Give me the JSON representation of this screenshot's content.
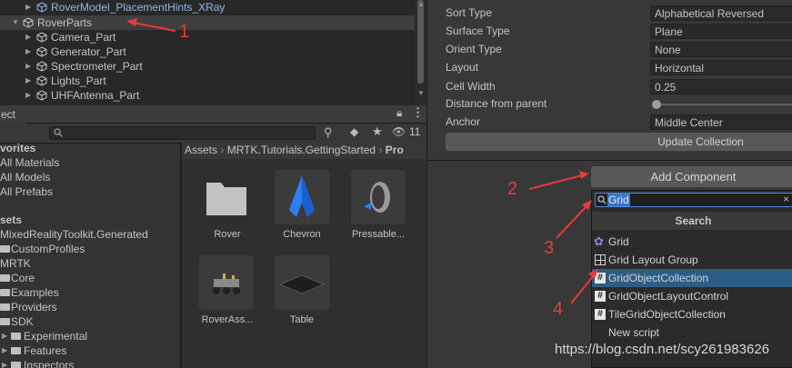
{
  "hierarchy": {
    "items": [
      {
        "label": "RoverModel_PlacementHints_XRay",
        "selected": false
      },
      {
        "label": "RoverParts",
        "selected": true
      },
      {
        "label": "Camera_Part",
        "selected": false
      },
      {
        "label": "Generator_Part",
        "selected": false
      },
      {
        "label": "Spectrometer_Part",
        "selected": false
      },
      {
        "label": "Lights_Part",
        "selected": false
      },
      {
        "label": "UHFAntenna_Part",
        "selected": false
      }
    ]
  },
  "project": {
    "tab_label": "ect",
    "hidden_count": "11",
    "breadcrumb": [
      "Assets",
      "MRTK.Tutorials.GettingStarted",
      "Pro"
    ],
    "tree": [
      {
        "label": "vorites",
        "bold": true
      },
      {
        "label": "All Materials"
      },
      {
        "label": "All Models"
      },
      {
        "label": "All Prefabs"
      },
      {
        "label": "sets",
        "bold": true
      },
      {
        "label": "MixedRealityToolkit.Generated"
      },
      {
        "label": "CustomProfiles"
      },
      {
        "label": "MRTK"
      },
      {
        "label": "Core"
      },
      {
        "label": "Examples"
      },
      {
        "label": "Providers"
      },
      {
        "label": "SDK"
      },
      {
        "label": "Experimental"
      },
      {
        "label": "Features"
      },
      {
        "label": "Inspectors"
      }
    ],
    "assets": [
      {
        "label": "Rover",
        "icon": "folder-icon"
      },
      {
        "label": "Chevron",
        "icon": "chevron-model-icon"
      },
      {
        "label": "Pressable...",
        "icon": "pressable-button-icon"
      },
      {
        "label": "RoverAss...",
        "icon": "rover-assembly-icon"
      },
      {
        "label": "Table",
        "icon": "table-model-icon"
      }
    ]
  },
  "inspector": {
    "properties": [
      {
        "label": "Sort Type",
        "value": "Alphabetical Reversed"
      },
      {
        "label": "Surface Type",
        "value": "Plane"
      },
      {
        "label": "Orient Type",
        "value": "None"
      },
      {
        "label": "Layout",
        "value": "Horizontal"
      },
      {
        "label": "Cell Width",
        "value": "0.25"
      },
      {
        "label": "Distance from parent",
        "value": ""
      },
      {
        "label": "Anchor",
        "value": "Middle Center"
      }
    ],
    "update_button": "Update Collection",
    "add_component": "Add Component"
  },
  "component_popup": {
    "search_value": "Grid",
    "header": "Search",
    "items": [
      {
        "label": "Grid",
        "selected": false
      },
      {
        "label": "Grid Layout Group",
        "selected": false
      },
      {
        "label": "GridObjectCollection",
        "selected": true
      },
      {
        "label": "GridObjectLayoutControl",
        "selected": false
      },
      {
        "label": "TileGridObjectCollection",
        "selected": false
      },
      {
        "label": "New script",
        "selected": false
      }
    ]
  },
  "annotations": {
    "numbers": [
      "1",
      "2",
      "3",
      "4"
    ],
    "color": "#e43c3c"
  },
  "watermark": "https://blog.csdn.net/scy261983626"
}
